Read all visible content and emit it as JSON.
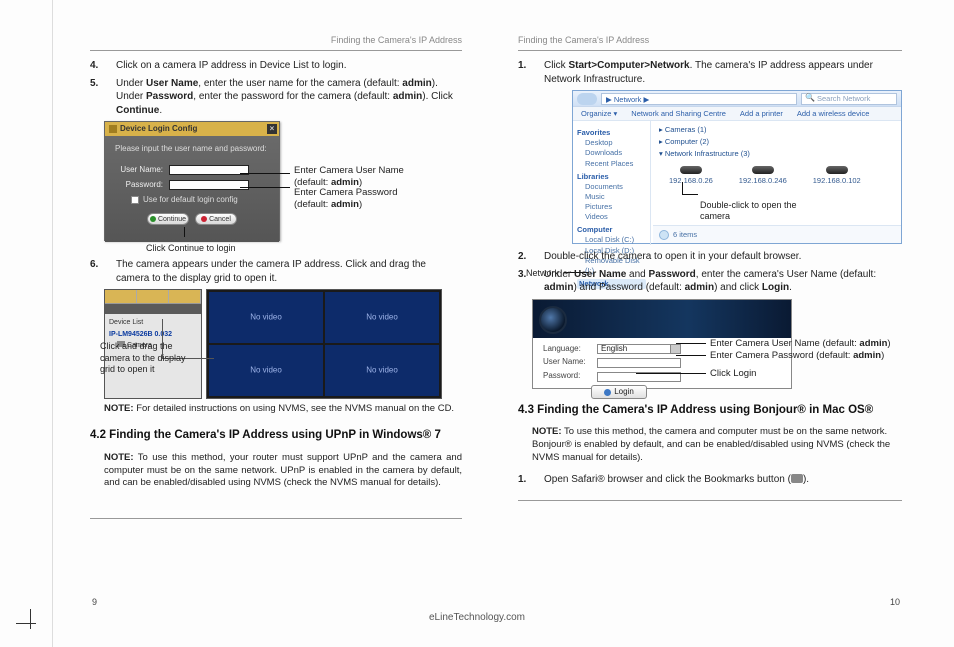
{
  "running_head": "Finding the Camera's IP Address",
  "page_left": "9",
  "page_right": "10",
  "footer_url": "eLineTechnology.com",
  "left": {
    "step4": "Click on a camera IP address in Device List to login.",
    "step5_a": "Under ",
    "step5_b_strong": "User Name",
    "step5_c": ", enter the user name for the camera (default: ",
    "admin": "admin",
    "step5_d": "). Under ",
    "step5_e_strong": "Password",
    "step5_f": ", enter the password for the camera (default: ",
    "step5_g": "). Click ",
    "step5_h_strong": "Continue",
    "period": ".",
    "login_dialog": {
      "title": "Device Login Config",
      "prompt": "Please input the user name and password:",
      "user_lbl": "User Name:",
      "pass_lbl": "Password:",
      "checkbox": "Use for default login config",
      "btn_continue": "Continue",
      "btn_cancel": "Cancel"
    },
    "callout_user_a": "Enter Camera User Name",
    "callout_user_b": "(default: ",
    "callout_user_b_strong": "admin",
    "callout_user_c": ")",
    "callout_pass_a": "Enter Camera Password",
    "callout_pass_b": "(default: ",
    "callout_pass_b_strong": "admin",
    "callout_pass_c": ")",
    "login_caption": "Click Continue to login",
    "step6": "The camera appears under the camera IP address. Click and drag the camera to the display grid to open it.",
    "nvms": {
      "tree_root": "Device List",
      "tree_ip": "IP-LM94526B 0.032",
      "tree_cam": "Camera",
      "cell_label": "No video"
    },
    "nvms_callout": "Click and drag the camera to the display grid to open it",
    "note_nvms_lbl": "NOTE:",
    "note_nvms": " For detailed instructions on using NVMS, see the NVMS manual on the CD.",
    "sec42_title": "4.2  Finding the Camera's IP Address using UPnP in Windows® 7",
    "note_upnp_lbl": "NOTE:",
    "note_upnp": " To use this method, your router must support UPnP and the camera and computer must be on the same network. UPnP is enabled in the camera by default, and can be enabled/disabled using NVMS (check the NVMS manual for details)."
  },
  "right": {
    "step1_a": "Click ",
    "step1_b_strong": "Start>Computer>Network",
    "step1_c": ". The camera's IP address appears under Network Infrastructure.",
    "explorer": {
      "breadcrumb": "▶ Network ▶",
      "search_placeholder": "Search Network",
      "cmd_organize": "Organize ▾",
      "cmd_center": "Network and Sharing Centre",
      "cmd_printer": "Add a printer",
      "cmd_wireless": "Add a wireless device",
      "side": {
        "fav": "Favorites",
        "desk": "Desktop",
        "down": "Downloads",
        "recent": "Recent Places",
        "lib": "Libraries",
        "doc": "Documents",
        "mus": "Music",
        "pic": "Pictures",
        "vid": "Videos",
        "comp": "Computer",
        "cdisk": "Local Disk (C:)",
        "ddisk": "Local Disk (D:)",
        "rem": "Removable Disk (I:)",
        "net": "Network"
      },
      "grp_cameras": "▸ Cameras (1)",
      "grp_computer": "▸ Computer (2)",
      "grp_infra": "▾ Network Infrastructure (3)",
      "cam_ips": [
        "192.168.0.26",
        "192.168.0.246",
        "192.168.0.102"
      ],
      "status_items": "6 items"
    },
    "callout_network": "Network",
    "callout_double": "Double-click to open the camera",
    "step2": "Double-click the camera to open it in your default browser.",
    "step3_a": "Under ",
    "step3_b_strong": "User Name",
    "step3_c": " and ",
    "step3_d_strong": "Password",
    "step3_e": ", enter the camera's User Name (default: ",
    "step3_f_strong": "admin",
    "step3_g": ") and Password (default: ",
    "step3_h_strong": "admin",
    "step3_i": ") and click ",
    "step3_j_strong": "Login",
    "period": ".",
    "web": {
      "lang_lbl": "Language:",
      "lang_val": "English",
      "user_lbl": "User Name:",
      "pass_lbl": "Password:",
      "login_btn": "Login"
    },
    "web_annot_user_a": "Enter Camera User Name (default: ",
    "web_annot_user_strong": "admin",
    "web_annot_user_b": ")",
    "web_annot_pass_a": "Enter Camera Password (default: ",
    "web_annot_pass_strong": "admin",
    "web_annot_pass_b": ")",
    "web_annot_login": "Click Login",
    "sec43_title": "4.3  Finding the Camera's IP Address using Bonjour® in Mac OS®",
    "note_bonjour_lbl": "NOTE:",
    "note_bonjour": " To use this method, the camera and computer must be on the same network. Bonjour® is enabled by default, and can be enabled/disabled using NVMS (check the NVMS manual for details).",
    "step1b_a": "Open Safari® browser and click the Bookmarks button (",
    "step1b_b": ")."
  }
}
